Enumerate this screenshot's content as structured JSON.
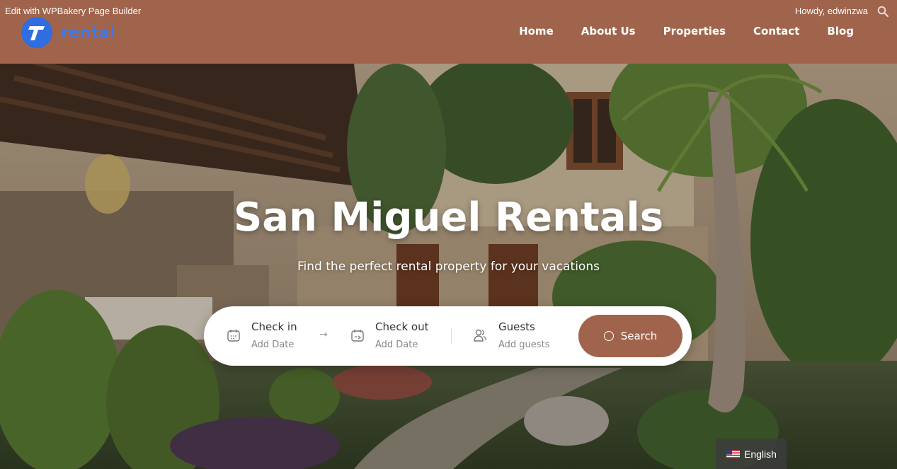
{
  "admin_bar": {
    "edit_link": "Edit with WPBakery Page Builder",
    "greeting": "Howdy, edwinzwa"
  },
  "brand": {
    "logo_letter": "T",
    "name": "rental",
    "accent_color": "#a0644d",
    "logo_color": "#2f6de0"
  },
  "nav": {
    "items": [
      {
        "label": "Home"
      },
      {
        "label": "About Us"
      },
      {
        "label": "Properties"
      },
      {
        "label": "Contact"
      },
      {
        "label": "Blog"
      }
    ]
  },
  "hero": {
    "title": "San Miguel Rentals",
    "subtitle": "Find the perfect rental property for your vacations"
  },
  "search": {
    "check_in": {
      "label": "Check in",
      "value": "Add Date",
      "icon": "calendar-icon"
    },
    "check_out": {
      "label": "Check out",
      "value": "Add Date",
      "icon": "calendar-icon"
    },
    "guests": {
      "label": "Guests",
      "value": "Add guests",
      "icon": "users-icon"
    },
    "button_label": "Search"
  },
  "language": {
    "label": "English",
    "flag": "us-flag-icon"
  }
}
